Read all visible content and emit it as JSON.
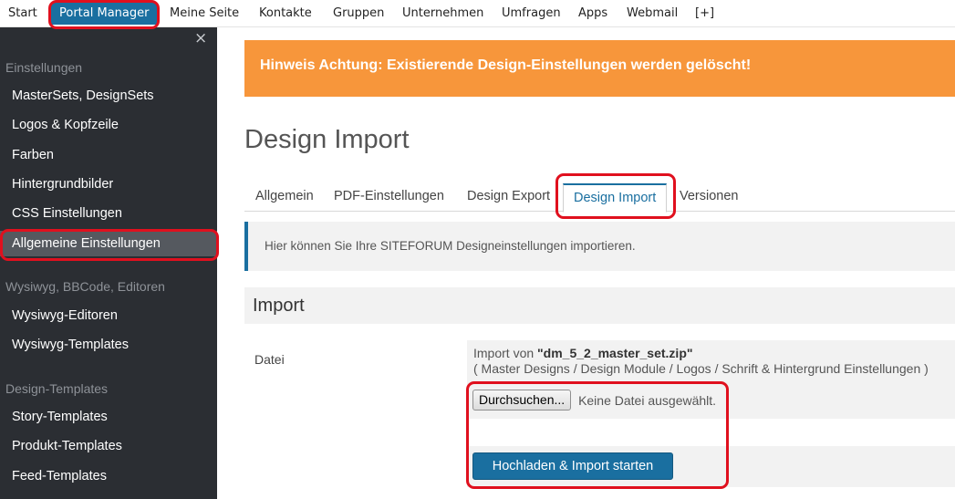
{
  "topnav": {
    "items": [
      "Start",
      "Portal Manager",
      "Meine Seite",
      "Kontakte",
      "Gruppen",
      "Unternehmen",
      "Umfragen",
      "Apps",
      "Webmail",
      "[+]"
    ],
    "active": "Portal Manager"
  },
  "sidebar": {
    "close_symbol": "×",
    "sections": [
      {
        "title": "Einstellungen",
        "items": [
          "MasterSets, DesignSets",
          "Logos & Kopfzeile",
          "Farben",
          "Hintergrundbilder",
          "CSS Einstellungen",
          "Allgemeine Einstellungen"
        ]
      },
      {
        "title": "Wysiwyg, BBCode, Editoren",
        "items": [
          "Wysiwyg-Editoren",
          "Wysiwyg-Templates"
        ]
      },
      {
        "title": "Design-Templates",
        "items": [
          "Story-Templates",
          "Produkt-Templates",
          "Feed-Templates"
        ]
      }
    ],
    "active": "Allgemeine Einstellungen"
  },
  "notice": "Hinweis Achtung: Existierende Design-Einstellungen werden gelöscht!",
  "page_title": "Design Import",
  "tabs": {
    "items": [
      "Allgemein",
      "PDF-Einstellungen",
      "Design Export",
      "Design Import",
      "Versionen"
    ],
    "active": "Design Import"
  },
  "info": "Hier können Sie Ihre SITEFORUM Designeinstellungen importieren.",
  "import": {
    "heading": "Import",
    "field_label": "Datei",
    "desc_prefix": "Import von ",
    "filename": "\"dm_5_2_master_set.zip\"",
    "desc_detail": "( Master Designs / Design Module / Logos / Schrift & Hintergrund Einstellungen )",
    "browse_label": "Durchsuchen...",
    "file_status": "Keine Datei ausgewählt.",
    "submit_label": "Hochladen & Import starten"
  },
  "colors": {
    "accent": "#1a6fa0",
    "notice": "#f7963b",
    "sidebar": "#2b2e33",
    "highlight_ring": "#e0101e"
  }
}
